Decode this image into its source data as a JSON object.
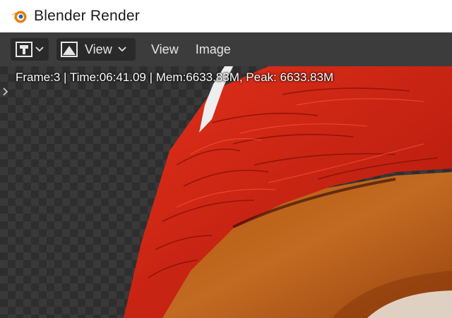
{
  "window": {
    "title": "Blender Render"
  },
  "header": {
    "editor_type_icon": "image-editor-icon",
    "view_dropdown_label": "View",
    "menus": [
      "View",
      "Image"
    ]
  },
  "viewport": {
    "stats": "Frame:3 | Time:06:41.09 | Mem:6633.83M, Peak: 6633.83M"
  },
  "colors": {
    "title_bg": "#ffffff",
    "header_bg": "#3c3c3c",
    "button_bg": "#2a2a2a",
    "render_red": "#c8240e",
    "render_orange": "#b65d24"
  }
}
